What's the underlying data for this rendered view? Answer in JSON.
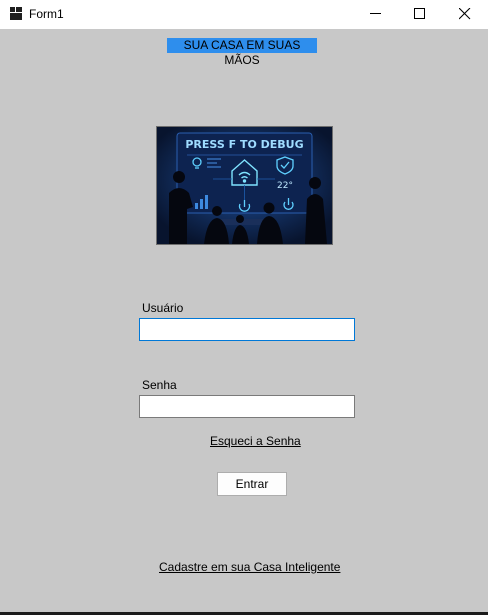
{
  "window": {
    "title": "Form1",
    "icon": "form-app-icon",
    "controls": {
      "minimize": "minimize-icon",
      "maximize": "maximize-icon",
      "close": "close-icon"
    }
  },
  "header": {
    "banner": "SUA CASA EM SUAS MÃOS",
    "banner_bg": "#2e8eed"
  },
  "logo": {
    "caption": "PRESS F TO DEBUG",
    "temperature": "22°"
  },
  "form": {
    "user_label": "Usuário",
    "user_value": "",
    "password_label": "Senha",
    "password_value": "",
    "forgot_link": "Esqueci a Senha",
    "submit_label": "Entrar",
    "register_link": "Cadastre em sua Casa Inteligente"
  },
  "colors": {
    "background": "#c8c8c8",
    "titlebar": "#ffffff",
    "focus_border": "#0078d7"
  }
}
